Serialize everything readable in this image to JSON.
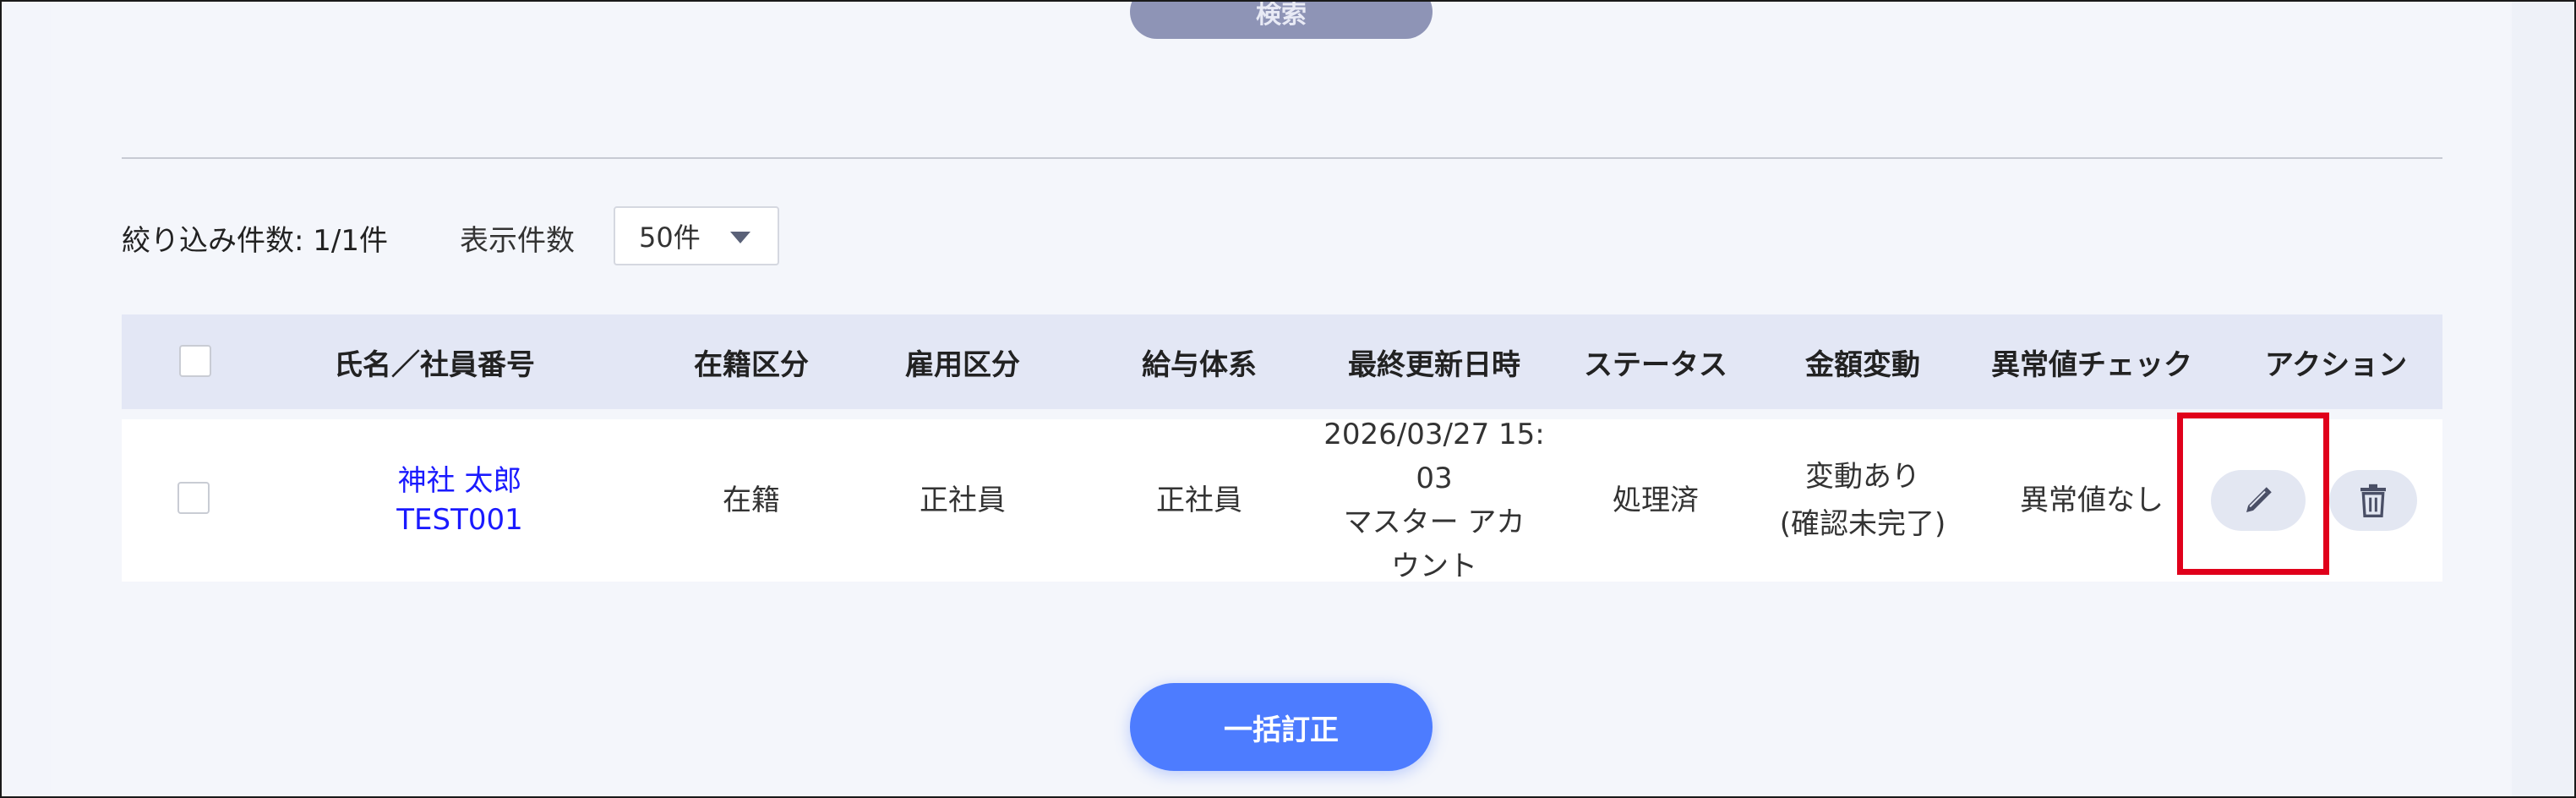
{
  "search_button": {
    "label": "検索"
  },
  "filter": {
    "count_label": "絞り込み件数: 1/1件",
    "display_count_label": "表示件数",
    "per_page_value": "50件"
  },
  "table": {
    "headers": [
      "氏名／社員番号",
      "在籍区分",
      "雇用区分",
      "給与体系",
      "最終更新日時",
      "ステータス",
      "金額変動",
      "異常値チェック",
      "アクション"
    ],
    "rows": [
      {
        "name": "神社 太郎",
        "employee_id": "TEST001",
        "enrollment": "在籍",
        "employment": "正社員",
        "pay_system": "正社員",
        "updated_line1": "2026/03/27 15:",
        "updated_line2": "03",
        "updated_line3": "マスター アカ",
        "updated_line4": "ウント",
        "status": "処理済",
        "amount_change_line1": "変動あり",
        "amount_change_line2": "(確認未完了)",
        "anomaly_check": "異常値なし"
      }
    ]
  },
  "bulk_button": {
    "label": "一括訂正"
  },
  "icons": {
    "edit": "pencil-icon",
    "delete": "trash-icon"
  },
  "colors": {
    "accent": "#4d7cff",
    "link": "#1a1aff",
    "highlight": "#e0001b",
    "header_bg": "#e3e7f5"
  }
}
